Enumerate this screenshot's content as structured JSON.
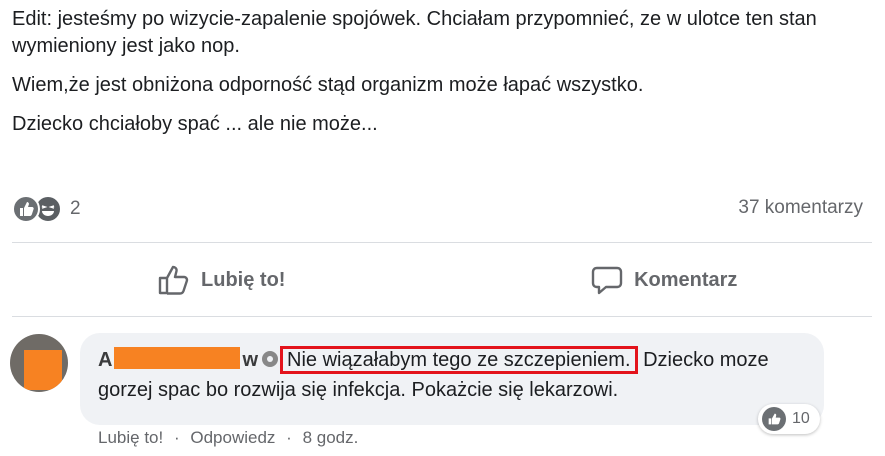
{
  "post": {
    "paragraphs": [
      "Edit: jesteśmy po wizycie-zapalenie spojówek. Chciałam przypomnieć, ze w ulotce ten stan wymieniony jest jako nop.",
      "Wiem,że jest obniżona odporność stąd organizm może łapać wszystko.",
      "Dziecko chciałoby spać ... ale nie może..."
    ]
  },
  "reactions": {
    "icons": [
      "like-icon",
      "haha-icon"
    ],
    "count": "2",
    "comments": "37 komentarzy"
  },
  "actions": {
    "like_label": "Lubię to!",
    "comment_label": "Komentarz"
  },
  "comment": {
    "author_first": "A",
    "author_last": "w",
    "highlighted": "Nie wiązałabym tego ze szczepieniem.",
    "rest": " Dziecko moze gorzej spac bo rozwija się infekcja. Pokażcie się lekarzowi.",
    "reaction_count": "10",
    "like_label": "Lubię to!",
    "reply_label": "Odpowiedz",
    "time": "8 godz.",
    "separator": "·"
  },
  "colors": {
    "highlight_border": "#e3131b",
    "redaction": "#f78222"
  }
}
